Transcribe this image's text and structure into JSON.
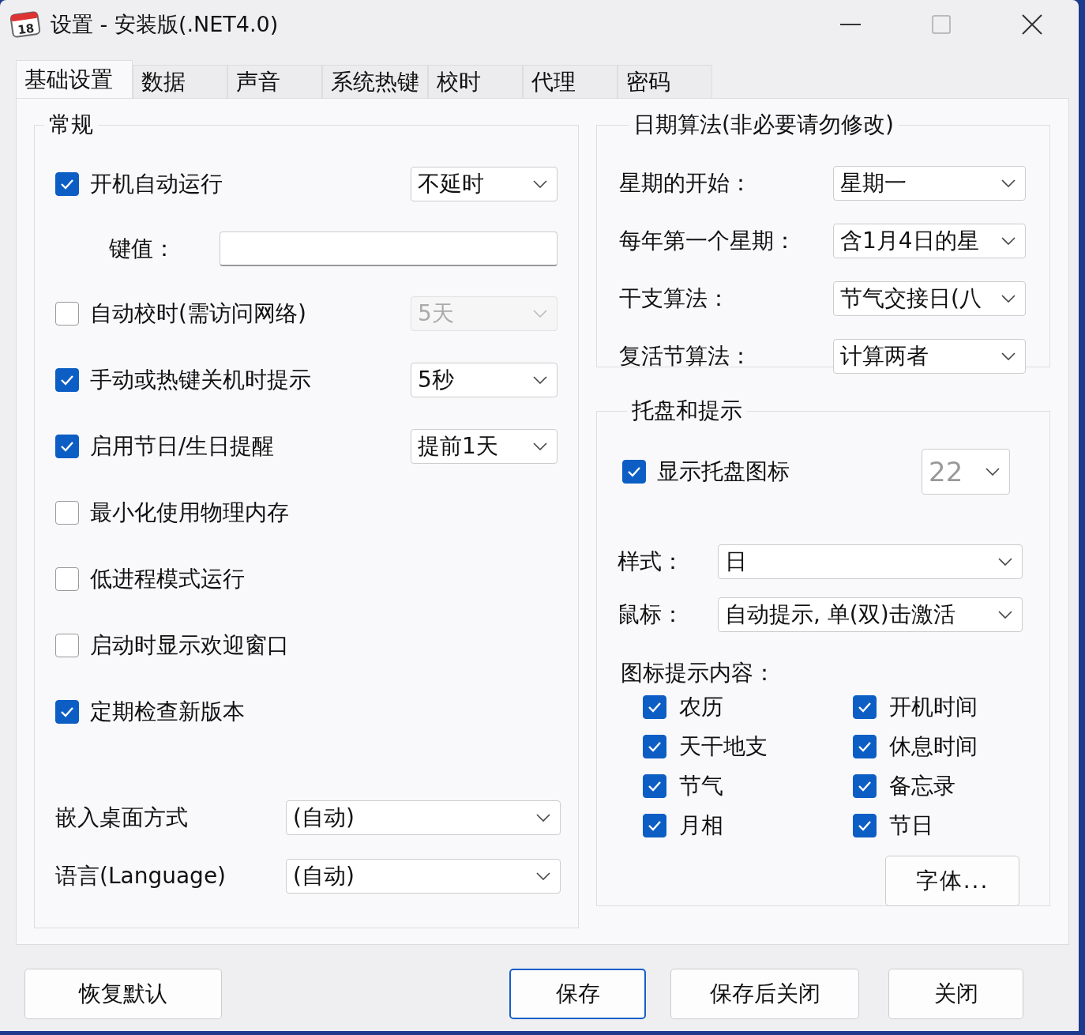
{
  "window": {
    "title": "设置 - 安装版(.NET4.0)",
    "app_icon_label": "18"
  },
  "tabs": [
    {
      "label": "基础设置",
      "selected": true
    },
    {
      "label": "数据",
      "selected": false
    },
    {
      "label": "声音",
      "selected": false
    },
    {
      "label": "系统热键",
      "selected": false
    },
    {
      "label": "校时",
      "selected": false
    },
    {
      "label": "代理",
      "selected": false
    },
    {
      "label": "密码",
      "selected": false
    }
  ],
  "general": {
    "title": "常规",
    "items": [
      {
        "kind": "checkbox",
        "label": "开机自动运行",
        "checked": true,
        "dropdown": {
          "value": "不延时",
          "disabled": false
        }
      },
      {
        "kind": "field",
        "label": "键值："
      },
      {
        "kind": "checkbox",
        "label": "自动校时(需访问网络)",
        "checked": false,
        "dropdown": {
          "value": "5天",
          "disabled": true
        }
      },
      {
        "kind": "checkbox",
        "label": "手动或热键关机时提示",
        "checked": true,
        "dropdown": {
          "value": "5秒",
          "disabled": false
        }
      },
      {
        "kind": "checkbox",
        "label": "启用节日/生日提醒",
        "checked": true,
        "dropdown": {
          "value": "提前1天",
          "disabled": false
        }
      },
      {
        "kind": "checkbox",
        "label": "最小化使用物理内存",
        "checked": false
      },
      {
        "kind": "checkbox",
        "label": "低进程模式运行",
        "checked": false
      },
      {
        "kind": "checkbox",
        "label": "启动时显示欢迎窗口",
        "checked": false
      },
      {
        "kind": "checkbox",
        "label": "定期检查新版本",
        "checked": true
      }
    ],
    "selects": [
      {
        "label": "嵌入桌面方式",
        "value": "(自动)"
      },
      {
        "label": "语言(Language)",
        "value": "(自动)"
      }
    ]
  },
  "date_algorithm": {
    "title": "日期算法(非必要请勿修改)",
    "rows": [
      {
        "label": "星期的开始：",
        "value": "星期一"
      },
      {
        "label": "每年第一个星期：",
        "value": "含1月4日的星"
      },
      {
        "label": "干支算法：",
        "value": "节气交接日(八"
      },
      {
        "label": "复活节算法：",
        "value": "计算两者"
      }
    ]
  },
  "tray": {
    "title": "托盘和提示",
    "show_icon": {
      "label": "显示托盘图标",
      "checked": true
    },
    "icon_size": "22",
    "selects": [
      {
        "label": "样式：",
        "value": "日"
      },
      {
        "label": "鼠标：",
        "value": "自动提示, 单(双)击激活"
      }
    ],
    "tooltip_title": "图标提示内容：",
    "tooltip_items": [
      {
        "label": "农历",
        "checked": true
      },
      {
        "label": "开机时间",
        "checked": true
      },
      {
        "label": "天干地支",
        "checked": true
      },
      {
        "label": "休息时间",
        "checked": true
      },
      {
        "label": "节气",
        "checked": true
      },
      {
        "label": "备忘录",
        "checked": true
      },
      {
        "label": "月相",
        "checked": true
      },
      {
        "label": "节日",
        "checked": true
      }
    ],
    "font_button": "字体..."
  },
  "buttons": [
    {
      "label": "恢复默认",
      "default": false
    },
    {
      "label": "保存",
      "default": true
    },
    {
      "label": "保存后关闭",
      "default": false
    },
    {
      "label": "关闭",
      "default": false
    }
  ]
}
